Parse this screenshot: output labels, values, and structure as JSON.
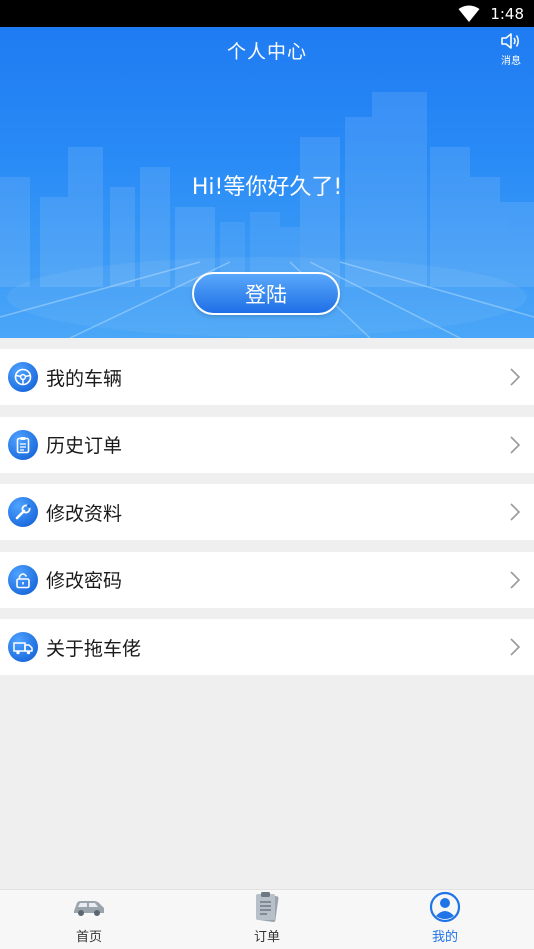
{
  "status_bar": {
    "time": "1:48"
  },
  "header": {
    "title": "个人中心",
    "message_label": "消息",
    "greeting": "Hi!等你好久了!",
    "login_label": "登陆"
  },
  "menu": {
    "items": [
      {
        "label": "我的车辆",
        "icon": "steering-wheel-icon"
      },
      {
        "label": "历史订单",
        "icon": "clipboard-icon"
      },
      {
        "label": "修改资料",
        "icon": "wrench-icon"
      },
      {
        "label": "修改密码",
        "icon": "lock-icon"
      },
      {
        "label": "关于拖车佬",
        "icon": "tow-truck-icon"
      }
    ]
  },
  "tabbar": {
    "tabs": [
      {
        "label": "首页",
        "icon": "car-icon",
        "active": false
      },
      {
        "label": "订单",
        "icon": "order-list-icon",
        "active": false
      },
      {
        "label": "我的",
        "icon": "user-icon",
        "active": true
      }
    ]
  },
  "colors": {
    "accent": "#1f74e8",
    "header_blue": "#2a8cf6",
    "background": "#efefef"
  }
}
